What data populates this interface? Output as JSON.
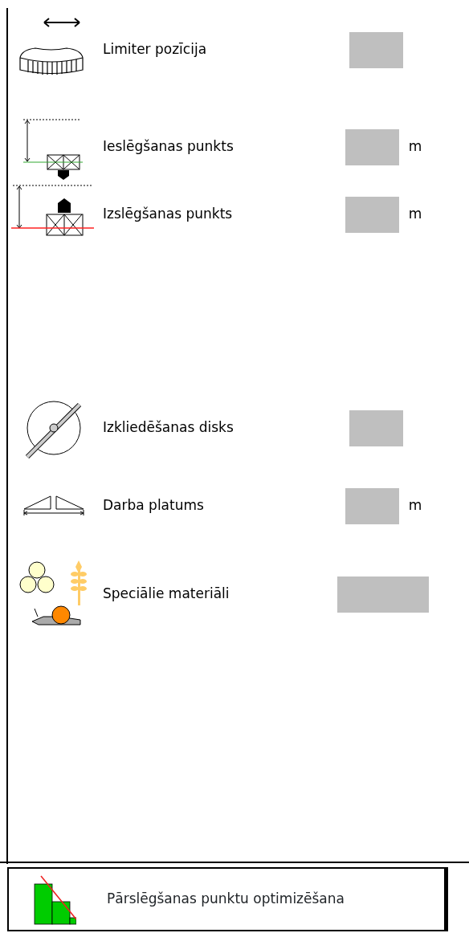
{
  "settings": [
    {
      "label": "Limiter pozīcija"
    },
    {
      "label": "Ieslēgšanas punkts",
      "unit": "m"
    },
    {
      "label": "Izslēgšanas punkts",
      "unit": "m"
    },
    {
      "label": "Izkliedēšanas disks"
    },
    {
      "label": "Darba platums",
      "unit": "m"
    },
    {
      "label": "Speciālie materiāli",
      "wide": true
    }
  ],
  "bottom_button": {
    "label": "Pārslēgšanas punktu optimizēšana"
  }
}
